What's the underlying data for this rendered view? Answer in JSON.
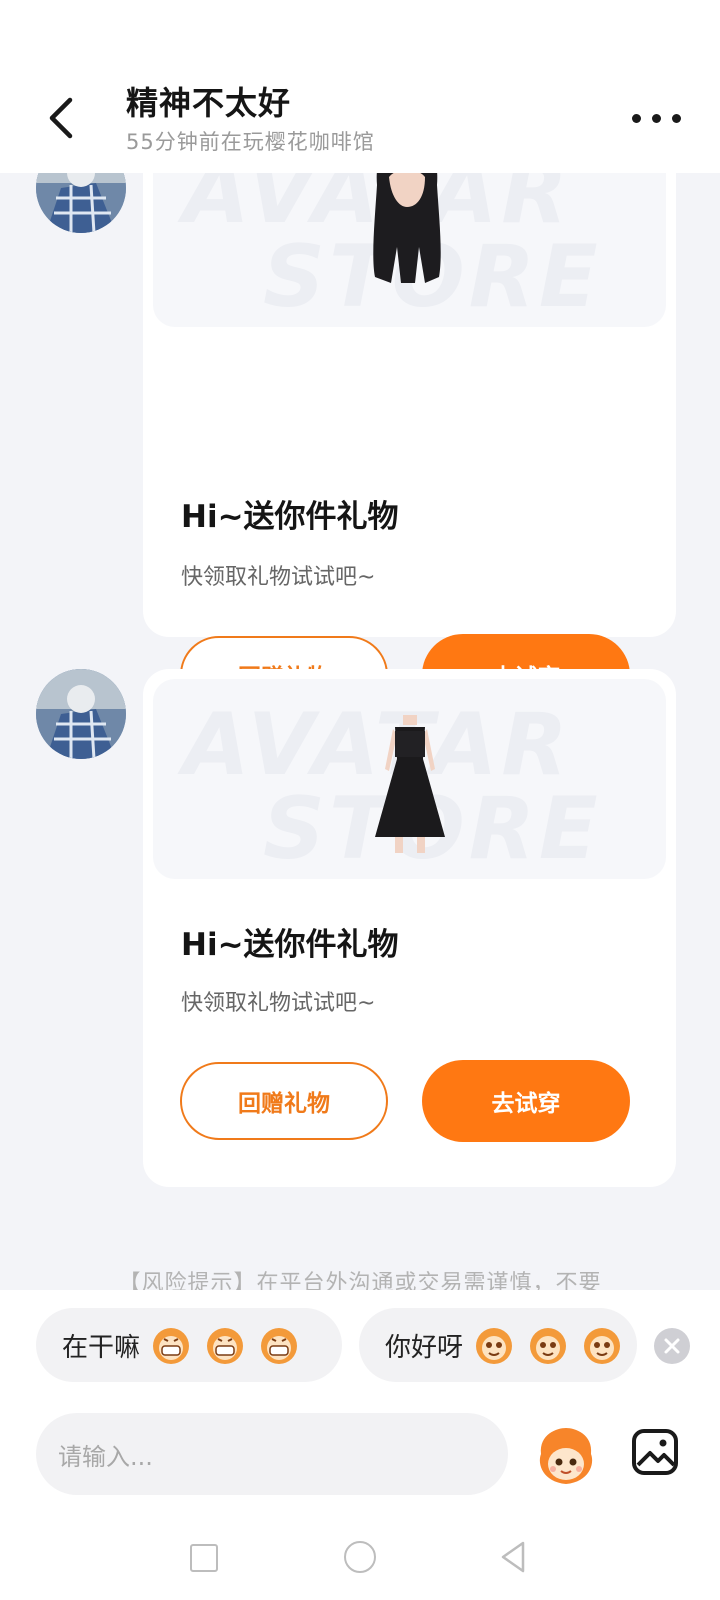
{
  "header": {
    "title": "精神不太好",
    "subtitle": "55分钟前在玩樱花咖啡馆"
  },
  "messages": [
    {
      "card_title": "Hi~送你件礼物",
      "card_subtitle": "快领取礼物试试吧~",
      "gift_item": "hair-icon",
      "return_gift_label": "回赠礼物",
      "try_on_label": "去试穿"
    },
    {
      "card_title": "Hi~送你件礼物",
      "card_subtitle": "快领取礼物试试吧~",
      "gift_item": "dress-icon",
      "return_gift_label": "回赠礼物",
      "try_on_label": "去试穿"
    }
  ],
  "watermark": {
    "line1": "AVATAR",
    "line2": "STORE"
  },
  "risk_notice": "【风险提示】在平台外沟通或交易需谨慎，不要",
  "quick_replies": [
    {
      "text": "在干嘛"
    },
    {
      "text": "你好呀"
    }
  ],
  "input": {
    "placeholder": "请输入..."
  },
  "colors": {
    "accent": "#ff7812",
    "outline": "#f07a1a"
  }
}
